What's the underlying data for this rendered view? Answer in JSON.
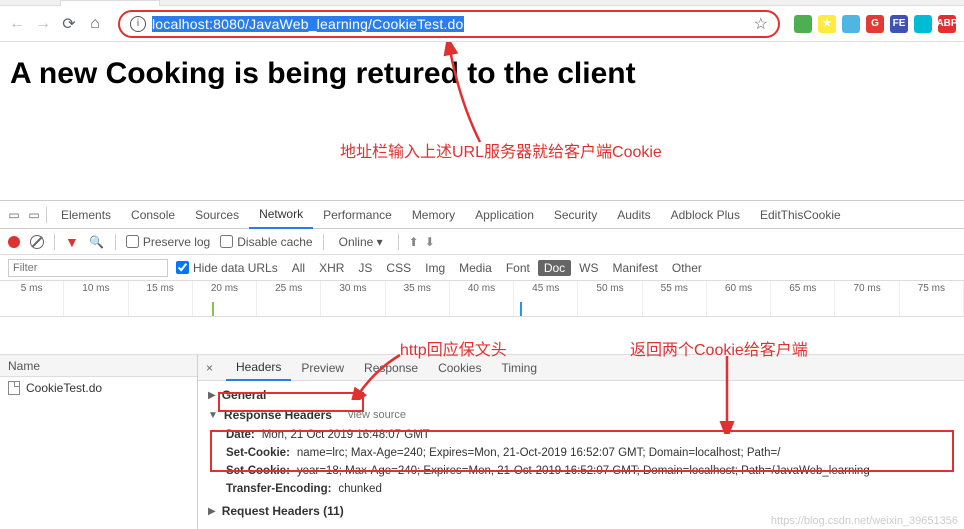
{
  "browser": {
    "url_prefix": "localhost",
    "url_rest": ":8080/JavaWeb_learning/CookieTest.do",
    "extensions": [
      {
        "bg": "#4caf50",
        "txt": ""
      },
      {
        "bg": "#ffeb3b",
        "txt": "★"
      },
      {
        "bg": "#4db6e2",
        "txt": ""
      },
      {
        "bg": "#e53935",
        "txt": "G"
      },
      {
        "bg": "#3f51b5",
        "txt": "FE"
      },
      {
        "bg": "#00bcd4",
        "txt": ""
      },
      {
        "bg": "#e03030",
        "txt": "ABP"
      }
    ]
  },
  "page": {
    "heading": "A new Cooking is being retured to the client"
  },
  "annotations": {
    "a1": "地址栏输入上述URL服务器就给客户端Cookie",
    "a2": "http回应保文头",
    "a3": "返回两个Cookie给客户端"
  },
  "devtools": {
    "tabs": [
      "Elements",
      "Console",
      "Sources",
      "Network",
      "Performance",
      "Memory",
      "Application",
      "Security",
      "Audits",
      "Adblock Plus",
      "EditThisCookie"
    ],
    "active_tab": "Network",
    "toolbar": {
      "preserve_log": "Preserve log",
      "disable_cache": "Disable cache",
      "online": "Online"
    },
    "filter": {
      "placeholder": "Filter",
      "hide_data_urls": "Hide data URLs",
      "types": [
        "All",
        "XHR",
        "JS",
        "CSS",
        "Img",
        "Media",
        "Font",
        "Doc",
        "WS",
        "Manifest",
        "Other"
      ],
      "active_type": "Doc"
    },
    "timeline": [
      "5 ms",
      "10 ms",
      "15 ms",
      "20 ms",
      "25 ms",
      "30 ms",
      "35 ms",
      "40 ms",
      "45 ms",
      "50 ms",
      "55 ms",
      "60 ms",
      "65 ms",
      "70 ms",
      "75 ms"
    ],
    "request_list": {
      "header": "Name",
      "items": [
        "CookieTest.do"
      ]
    },
    "detail_tabs": [
      "Headers",
      "Preview",
      "Response",
      "Cookies",
      "Timing"
    ],
    "active_detail_tab": "Headers",
    "headers": {
      "general_label": "General",
      "response_headers_label": "Response Headers",
      "view_source": "view source",
      "date_k": "Date:",
      "date_v": "Mon, 21 Oct 2019 16:48:07 GMT",
      "cookie1_k": "Set-Cookie:",
      "cookie1_v": "name=lrc; Max-Age=240; Expires=Mon, 21-Oct-2019 16:52:07 GMT; Domain=localhost; Path=/",
      "cookie2_k": "Set-Cookie:",
      "cookie2_v": "year=18; Max-Age=240; Expires=Mon, 21-Oct-2019 16:52:07 GMT; Domain=localhost; Path=/JavaWeb_learning",
      "transfer_k": "Transfer-Encoding:",
      "transfer_v": "chunked",
      "request_headers_label": "Request Headers (11)"
    }
  },
  "watermark": "https://blog.csdn.net/weixin_39651356"
}
